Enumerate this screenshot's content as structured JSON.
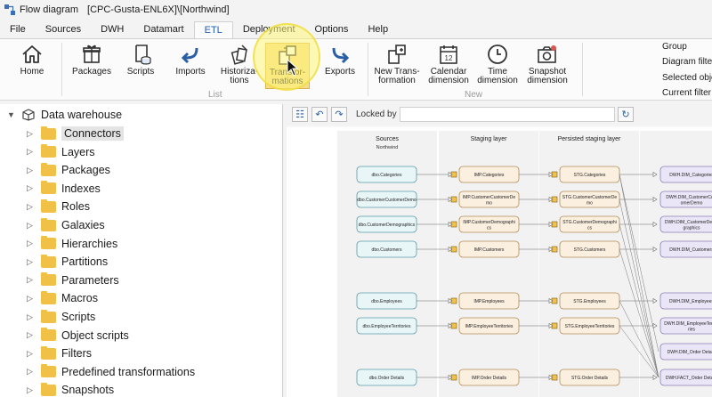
{
  "titlebar": {
    "app": "Flow diagram",
    "context": "[CPC-Gusta-ENL6X]\\[Northwind]"
  },
  "menu": {
    "tabs": [
      {
        "label": "File"
      },
      {
        "label": "Sources"
      },
      {
        "label": "DWH"
      },
      {
        "label": "Datamart"
      },
      {
        "label": "ETL",
        "active": true
      },
      {
        "label": "Deployment"
      },
      {
        "label": "Options"
      },
      {
        "label": "Help"
      }
    ]
  },
  "ribbon": {
    "home": "Home",
    "packages": "Packages",
    "scripts": "Scripts",
    "imports": "Imports",
    "historizations": "Historiza-\ntions",
    "transformations": "Transfor-\nmations",
    "exports": "Exports",
    "new_transformation": "New Trans-\nformation",
    "calendar_dimension": "Calendar\ndimension",
    "time_dimension": "Time\ndimension",
    "snapshot_dimension": "Snapshot\ndimension",
    "group_list": "List",
    "group_new": "New",
    "side": [
      "Group",
      "Diagram filter",
      "Selected objects",
      "Current filter"
    ],
    "calendar_day": "12"
  },
  "tree": {
    "root": "Data warehouse",
    "items": [
      {
        "label": "Connectors",
        "selected": true
      },
      {
        "label": "Layers"
      },
      {
        "label": "Packages"
      },
      {
        "label": "Indexes"
      },
      {
        "label": "Roles"
      },
      {
        "label": "Galaxies"
      },
      {
        "label": "Hierarchies"
      },
      {
        "label": "Partitions"
      },
      {
        "label": "Parameters"
      },
      {
        "label": "Macros"
      },
      {
        "label": "Scripts"
      },
      {
        "label": "Object scripts"
      },
      {
        "label": "Filters"
      },
      {
        "label": "Predefined transformations"
      },
      {
        "label": "Snapshots"
      }
    ]
  },
  "diagram": {
    "locked_by_label": "Locked by",
    "locked_by_value": "",
    "columns": [
      {
        "title": "Sources",
        "subtitle": "Northwind"
      },
      {
        "title": "Staging layer"
      },
      {
        "title": "Persisted staging layer"
      },
      {
        "title": ""
      }
    ],
    "rows": [
      {
        "src": "dbo.Categories",
        "imp": "IMP.Categories",
        "stg": "STG.Categories",
        "dwh": [
          "DWH.DIM_Categories"
        ]
      },
      {
        "src": "dbo.CustomerCustomerDemo",
        "imp": "IMP.CustomerCustomerDe\nmo",
        "stg": "STG.CustomerCustomerDe\nmo",
        "dwh": [
          "DWH.DIM_CustomerCust\nomerDemo"
        ]
      },
      {
        "src": "dbo.CustomerDemographics",
        "imp": "IMP.CustomerDemographi\ncs",
        "stg": "STG.CustomerDemographi\ncs",
        "dwh": [
          "DWH.DIM_CustomerDemo\ngraphics"
        ]
      },
      {
        "src": "dbo.Customers",
        "imp": "IMP.Customers",
        "stg": "STG.Customers",
        "dwh": [
          "DWH.DIM_Customers"
        ]
      },
      {
        "src": "dbo.Employees",
        "imp": "IMP.Employees",
        "stg": "STG.Employees",
        "dwh": [
          "DWH.DIM_Employees"
        ]
      },
      {
        "src": "dbo.EmployeeTerritories",
        "imp": "IMP.EmployeeTerritories",
        "stg": "STG.EmployeeTerritories",
        "dwh": [
          "DWH.DIM_EmployeeTerrito\nries"
        ]
      },
      {
        "src": "dbo.Order Details",
        "imp": "IMP.Order Details",
        "stg": "STG.Order Details",
        "dwh": [
          "DWH.DIM_Order Details",
          "DWH.FACT_Order Details"
        ]
      }
    ]
  },
  "colors": {
    "source_fill": "#e9f6f8",
    "source_stroke": "#5a9aa8",
    "staging_fill": "#fbefdf",
    "staging_stroke": "#b38d5a",
    "dwh_fill": "#ebe6f7",
    "dwh_stroke": "#8c7fb3",
    "highlight": "#f3dc8b",
    "folder": "#f0c146"
  }
}
